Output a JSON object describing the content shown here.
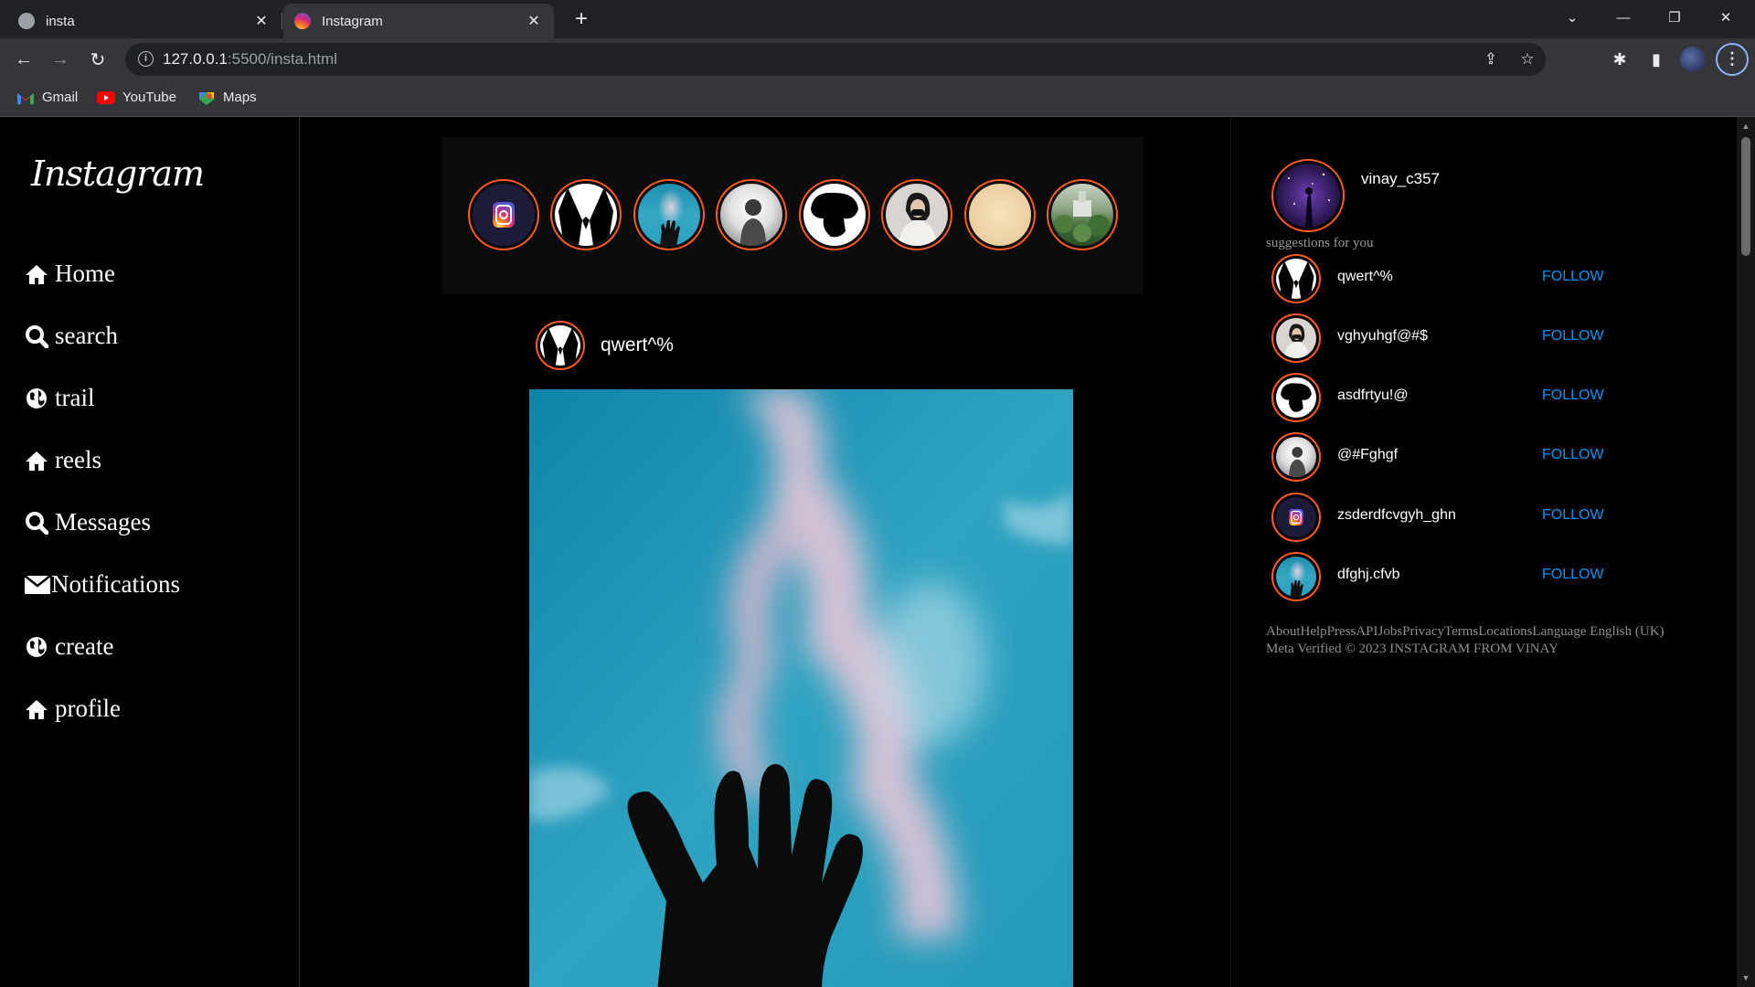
{
  "browser": {
    "tabs": [
      {
        "title": "insta",
        "active": false
      },
      {
        "title": "Instagram",
        "active": true
      }
    ],
    "url_host": "127.0.0.1",
    "url_path": ":5500/insta.html",
    "bookmarks": [
      {
        "label": "Gmail",
        "icon": "gmail-icon"
      },
      {
        "label": "YouTube",
        "icon": "youtube-icon"
      },
      {
        "label": "Maps",
        "icon": "maps-icon"
      }
    ]
  },
  "logo": "Instagram",
  "nav": [
    {
      "label": "Home",
      "icon": "home-icon"
    },
    {
      "label": "search",
      "icon": "search-icon"
    },
    {
      "label": "trail",
      "icon": "globe-icon"
    },
    {
      "label": "reels",
      "icon": "home-icon"
    },
    {
      "label": "Messages",
      "icon": "search-icon"
    },
    {
      "label": "Notifications",
      "icon": "envelope-icon"
    },
    {
      "label": "create",
      "icon": "globe-icon"
    },
    {
      "label": "profile",
      "icon": "home-icon"
    }
  ],
  "post": {
    "username": "qwert^%"
  },
  "current_user": {
    "username": "vinay_c357"
  },
  "suggestions_heading": "suggestions for you",
  "suggestions": [
    {
      "username": "qwert^%",
      "action": "FOLLOW"
    },
    {
      "username": "vghyuhgf@#$",
      "action": "FOLLOW"
    },
    {
      "username": "asdfrtyu!@",
      "action": "FOLLOW"
    },
    {
      "username": "@#Fghgf",
      "action": "FOLLOW"
    },
    {
      "username": "zsderdfcvgyh_ghn",
      "action": "FOLLOW"
    },
    {
      "username": "dfghj.cfvb",
      "action": "FOLLOW"
    }
  ],
  "footer": "AboutHelpPressAPIJobsPrivacyTermsLocationsLanguage English (UK) Meta Verified © 2023 INSTAGRAM FROM VINAY",
  "colors": {
    "story_ring": "#ff5a1f",
    "follow": "#0095f6"
  }
}
